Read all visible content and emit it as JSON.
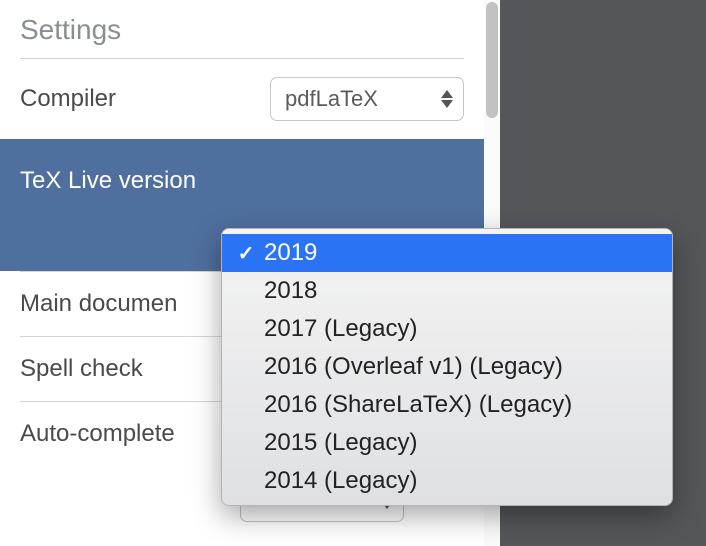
{
  "title": "Settings",
  "rows": {
    "compiler": {
      "label": "Compiler",
      "value": "pdfLaTeX"
    },
    "texlive": {
      "label": "TeX Live version"
    },
    "maindoc": {
      "label": "Main documen"
    },
    "spell": {
      "label": "Spell check"
    },
    "autocomp": {
      "label": "Auto-complete"
    }
  },
  "dropdown": {
    "options": [
      {
        "label": "2019",
        "selected": true
      },
      {
        "label": "2018",
        "selected": false
      },
      {
        "label": "2017 (Legacy)",
        "selected": false
      },
      {
        "label": "2016 (Overleaf v1) (Legacy)",
        "selected": false
      },
      {
        "label": "2016 (ShareLaTeX) (Legacy)",
        "selected": false
      },
      {
        "label": "2015 (Legacy)",
        "selected": false
      },
      {
        "label": "2014 (Legacy)",
        "selected": false
      }
    ]
  }
}
